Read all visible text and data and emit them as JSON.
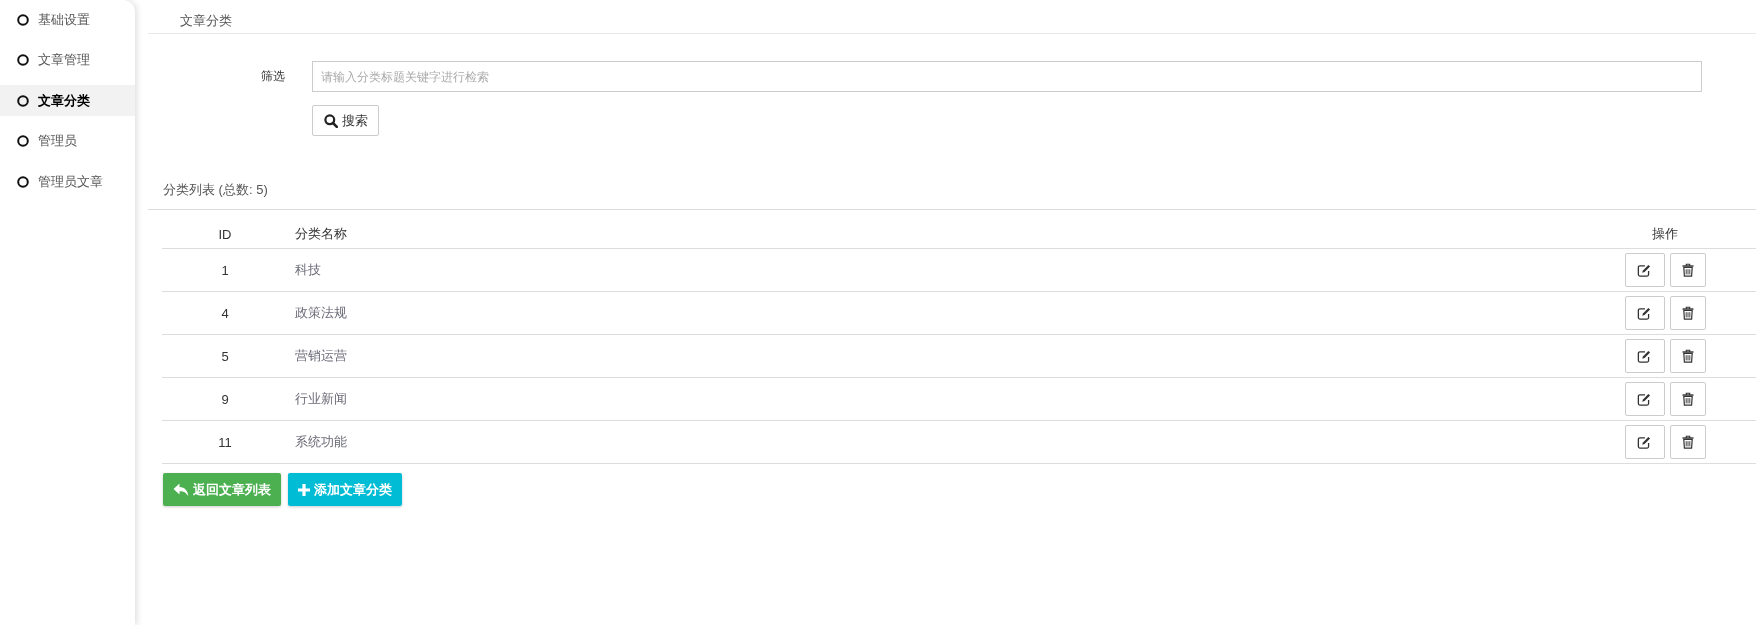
{
  "sidebar": {
    "items": [
      {
        "label": "基础设置",
        "selected": false
      },
      {
        "label": "文章管理",
        "selected": false
      },
      {
        "label": "文章分类",
        "selected": true
      },
      {
        "label": "管理员",
        "selected": false
      },
      {
        "label": "管理员文章",
        "selected": false
      }
    ]
  },
  "breadcrumb": "文章分类",
  "filter": {
    "label": "筛选",
    "placeholder": "请输入分类标题关键字进行检索",
    "search_button": "搜索"
  },
  "list": {
    "title": "分类列表 (总数: 5)"
  },
  "table": {
    "columns": [
      "ID",
      "分类名称",
      "操作"
    ],
    "rows": [
      {
        "id": "1",
        "name": "科技"
      },
      {
        "id": "4",
        "name": "政策法规"
      },
      {
        "id": "5",
        "name": "营销运营"
      },
      {
        "id": "9",
        "name": "行业新闻"
      },
      {
        "id": "11",
        "name": "系统功能"
      }
    ]
  },
  "actions": [
    {
      "kind": "back",
      "label": "返回文章列表"
    },
    {
      "kind": "add",
      "label": "添加文章分类"
    }
  ]
}
